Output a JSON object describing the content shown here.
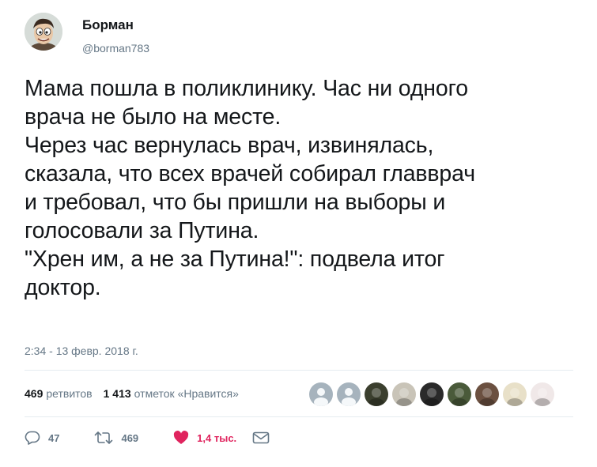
{
  "author": {
    "display_name": "Борман",
    "handle": "@borman783"
  },
  "tweet": {
    "lines": [
      "Мама пошла в поликлинику. Час ни одного",
      "врача не было на месте.",
      "Через час вернулась врач, извинялась,",
      "сказала, что всех врачей собирал главврач",
      "и требовал, что бы пришли на выборы и",
      "голосовали за Путина.",
      "\"Хрен им, а не за Путина!\": подвела итог",
      "доктор."
    ],
    "timestamp": "2:34 - 13 февр. 2018 г."
  },
  "stats": {
    "retweets_count": "469",
    "retweets_label": "ретвитов",
    "likes_count": "1 413",
    "likes_label": "отметок «Нравится»"
  },
  "liker_avatars": [
    {
      "icon": "default-avatar-icon",
      "color": "#a6b3bd"
    },
    {
      "icon": "default-avatar-icon",
      "color": "#a6b3bd"
    },
    {
      "icon": "user-photo-avatar",
      "color": "#3b3f2e"
    },
    {
      "icon": "user-photo-avatar",
      "color": "#c9c4b8"
    },
    {
      "icon": "user-photo-avatar",
      "color": "#2a2a2a"
    },
    {
      "icon": "user-photo-avatar",
      "color": "#4a5a3a"
    },
    {
      "icon": "user-photo-avatar",
      "color": "#6b5040"
    },
    {
      "icon": "user-photo-avatar",
      "color": "#e8e0c8"
    },
    {
      "icon": "user-photo-avatar",
      "color": "#f0e8e8"
    }
  ],
  "actions": {
    "reply_count": "47",
    "retweet_count": "469",
    "like_count": "1,4 тыс."
  },
  "colors": {
    "text": "#14171a",
    "secondary": "#657786",
    "like": "#e0245e",
    "divider": "#e6ecf0"
  }
}
